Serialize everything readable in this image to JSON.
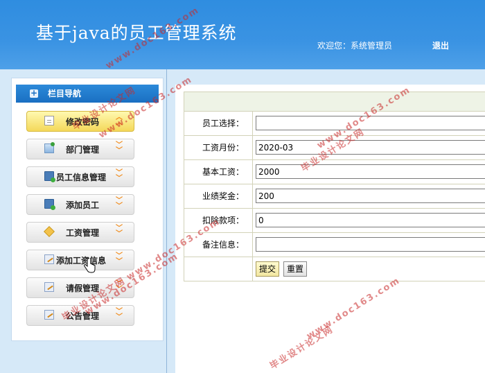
{
  "header": {
    "title": "基于java的员工管理系统",
    "welcome": "欢迎您：系统管理员",
    "logout": "退出"
  },
  "sidebar": {
    "title": "栏目导航",
    "items": [
      {
        "label": "修改密码",
        "icon": "document-icon",
        "chevron": "up",
        "active": true
      },
      {
        "label": "部门管理",
        "icon": "arrow-up-icon",
        "chevron": "down"
      },
      {
        "label": "员工信息管理",
        "icon": "monitor-user-icon",
        "chevron": "down"
      },
      {
        "label": "添加员工",
        "icon": "monitor-user-icon",
        "chevron": "down"
      },
      {
        "label": "工资管理",
        "icon": "box-icon",
        "chevron": "down"
      },
      {
        "label": "添加工资信息",
        "icon": "edit-icon",
        "chevron": "down"
      },
      {
        "label": "请假管理",
        "icon": "edit-icon",
        "chevron": "down"
      },
      {
        "label": "公告管理",
        "icon": "edit-icon",
        "chevron": "down"
      }
    ]
  },
  "form": {
    "fields": [
      {
        "label": "员工选择：",
        "value": ""
      },
      {
        "label": "工资月份：",
        "value": "2020-03"
      },
      {
        "label": "基本工资：",
        "value": "2000"
      },
      {
        "label": "业绩奖金：",
        "value": "200"
      },
      {
        "label": "扣除款项：",
        "value": "0"
      },
      {
        "label": "备注信息：",
        "value": ""
      }
    ],
    "submit_label": "提交",
    "reset_label": "重置"
  },
  "watermark": {
    "text_cn": "毕业设计论文网",
    "text_url": "www.doc163.com"
  }
}
